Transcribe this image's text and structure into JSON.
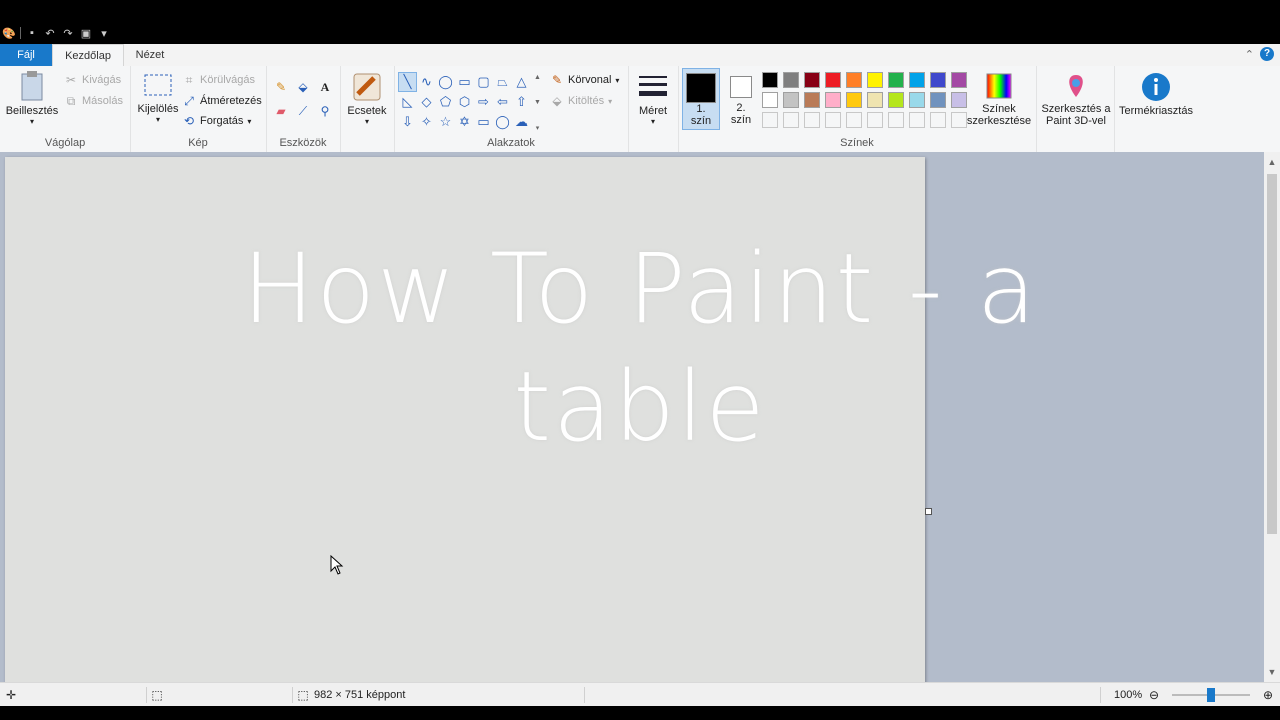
{
  "tabs": {
    "file": "Fájl",
    "home": "Kezdőlap",
    "view": "Nézet"
  },
  "clipboard": {
    "paste": "Beillesztés",
    "cut": "Kivágás",
    "copy": "Másolás",
    "label": "Vágólap"
  },
  "image": {
    "select": "Kijelölés",
    "crop": "Körülvágás",
    "resize": "Átméretezés",
    "rotate": "Forgatás",
    "label": "Kép"
  },
  "tools": {
    "label": "Eszközök",
    "brushes": "Ecsetek"
  },
  "shapes": {
    "outline": "Körvonal",
    "fill": "Kitöltés",
    "label": "Alakzatok"
  },
  "size": {
    "label": "Méret"
  },
  "colors": {
    "color1_line1": "1.",
    "color1_line2": "szín",
    "color2_line1": "2.",
    "color2_line2": "szín",
    "edit_colors_line1": "Színek",
    "edit_colors_line2": "szerkesztése",
    "paint3d_line1": "Szerkesztés a",
    "paint3d_line2": "Paint 3D-vel",
    "product_alert": "Termékriasztás",
    "label": "Színek",
    "palette_row1": [
      "#000000",
      "#7f7f7f",
      "#880015",
      "#ed1c24",
      "#ff7f27",
      "#fff200",
      "#22b14c",
      "#00a2e8",
      "#3f48cc",
      "#a349a4"
    ],
    "palette_row2": [
      "#ffffff",
      "#c3c3c3",
      "#b97a57",
      "#ffaec9",
      "#ffc90e",
      "#efe4b0",
      "#b5e61d",
      "#99d9ea",
      "#7092be",
      "#c8bfe7"
    ],
    "palette_row3": [
      "#f5f6f7",
      "#f5f6f7",
      "#f5f6f7",
      "#f5f6f7",
      "#f5f6f7",
      "#f5f6f7",
      "#f5f6f7",
      "#f5f6f7",
      "#f5f6f7",
      "#f5f6f7"
    ]
  },
  "overlay": {
    "line1": "How To Paint - a",
    "line2": "table"
  },
  "status": {
    "dimensions": "982 × 751 képpont",
    "zoom": "100%"
  }
}
